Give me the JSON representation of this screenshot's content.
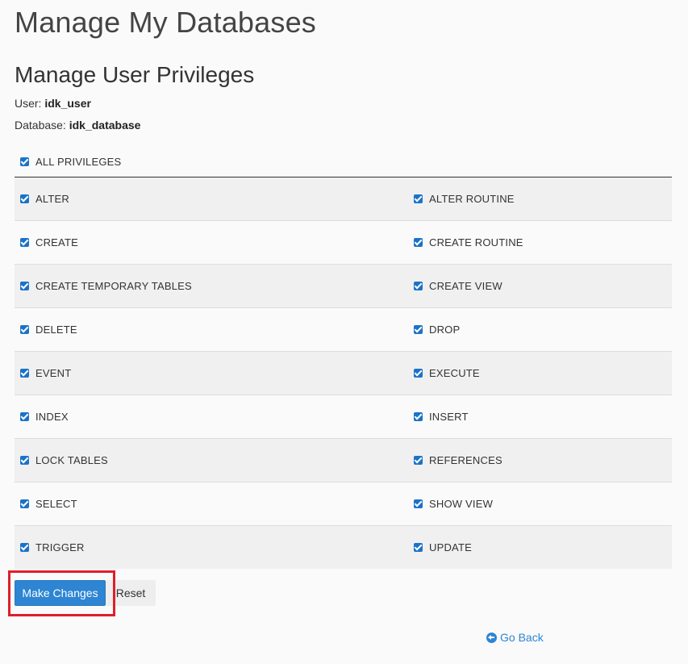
{
  "page": {
    "title": "Manage My Databases",
    "section_title": "Manage User Privileges",
    "user_label": "User:",
    "user_value": "idk_user",
    "database_label": "Database:",
    "database_value": "idk_database"
  },
  "all_privileges": {
    "label": "ALL PRIVILEGES",
    "checked": true
  },
  "privileges": [
    {
      "left": "ALTER",
      "right": "ALTER ROUTINE"
    },
    {
      "left": "CREATE",
      "right": "CREATE ROUTINE"
    },
    {
      "left": "CREATE TEMPORARY TABLES",
      "right": "CREATE VIEW"
    },
    {
      "left": "DELETE",
      "right": "DROP"
    },
    {
      "left": "EVENT",
      "right": "EXECUTE"
    },
    {
      "left": "INDEX",
      "right": "INSERT"
    },
    {
      "left": "LOCK TABLES",
      "right": "REFERENCES"
    },
    {
      "left": "SELECT",
      "right": "SHOW VIEW"
    },
    {
      "left": "TRIGGER",
      "right": "UPDATE"
    }
  ],
  "actions": {
    "make_changes_label": "Make Changes",
    "reset_label": "Reset",
    "go_back_label": "Go Back"
  },
  "colors": {
    "accent": "#2d85d3",
    "highlight": "#e01e2b",
    "checkbox": "#1a73c8"
  },
  "icons": {
    "checkbox": "checkbox-checked-icon",
    "go_back": "circle-arrow-left-icon"
  }
}
